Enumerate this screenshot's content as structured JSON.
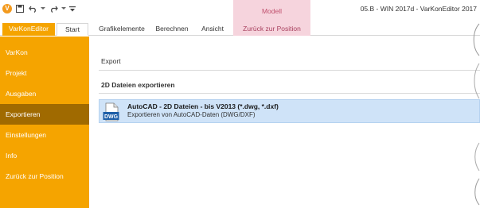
{
  "window": {
    "title": "05.B - WIN 2017d - VarKonEditor 2017",
    "context_group_label": "Modell"
  },
  "quick_access": {
    "icons": [
      "app-icon",
      "save-icon",
      "undo-icon",
      "undo-dropdown-icon",
      "redo-icon",
      "redo-dropdown-icon",
      "customize-icon"
    ]
  },
  "ribbon": {
    "tabs": [
      {
        "label": "VarKonEditor"
      },
      {
        "label": "Start"
      },
      {
        "label": "Grafikelemente"
      },
      {
        "label": "Berechnen"
      },
      {
        "label": "Ansicht"
      },
      {
        "label": "Zurück zur Position"
      }
    ]
  },
  "nav": {
    "items": [
      {
        "label": "VarKon"
      },
      {
        "label": "Projekt"
      },
      {
        "label": "Ausgaben"
      },
      {
        "label": "Exportieren"
      },
      {
        "label": "Einstellungen"
      },
      {
        "label": "Info"
      },
      {
        "label": "Zurück zur Position"
      }
    ]
  },
  "main": {
    "section_title": "Export",
    "subsection_title": "2D Dateien exportieren",
    "items": [
      {
        "title": "AutoCAD - 2D Dateien - bis V2013 (*.dwg, *.dxf)",
        "description": "Exportieren von AutoCAD-Daten (DWG/DXF)",
        "icon_label": "DWG"
      }
    ]
  },
  "colors": {
    "accent": "#f5a400",
    "nav_active": "#a06a00",
    "context_tab": "#f6d4dd",
    "selection": "#cfe3f8"
  }
}
